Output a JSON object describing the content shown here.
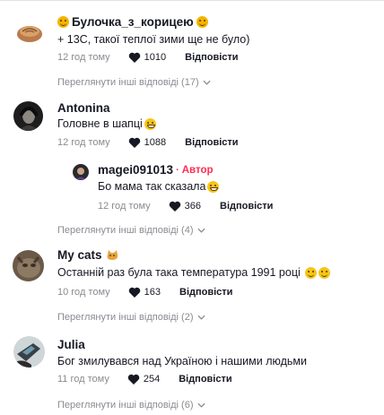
{
  "comments": [
    {
      "username": "Булочка_з_корицею",
      "text": "+ 13С, такої теплої зими ще не було)",
      "time": "12 год тому",
      "likes": "1010",
      "reply_label": "Відповісти",
      "more_replies": "Переглянути інші відповіді (17)"
    },
    {
      "username": "Antonina",
      "text": "Головне в шапці",
      "time": "12 год тому",
      "likes": "1088",
      "reply_label": "Відповісти",
      "reply": {
        "username": "magei091013",
        "author_badge": "Автор",
        "separator": "·",
        "text": "Бо мама так сказала",
        "time": "12 год тому",
        "likes": "366",
        "reply_label": "Відповісти"
      },
      "more_replies": "Переглянути інші відповіді (4)"
    },
    {
      "username": "My cats",
      "text": "Останній раз була така температура 1991 році",
      "time": "10 год тому",
      "likes": "163",
      "reply_label": "Відповісти",
      "more_replies": "Переглянути інші відповіді (2)"
    },
    {
      "username": "Julia",
      "text": "Бог змилувався над Україною і нашими людьми",
      "time": "11 год тому",
      "likes": "254",
      "reply_label": "Відповісти",
      "more_replies": "Переглянути інші відповіді (6)"
    }
  ],
  "colors": {
    "author": "#fe2c55",
    "muted": "#8a8b91",
    "text": "#161823"
  },
  "icons": {
    "like": "heart-icon",
    "expand": "chevron-down-icon"
  }
}
